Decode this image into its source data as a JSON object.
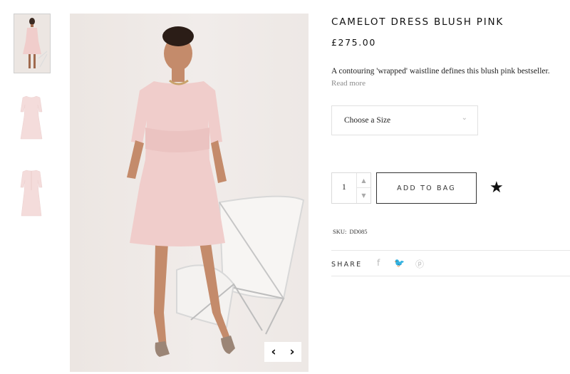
{
  "product": {
    "title": "CAMELOT DRESS BLUSH PINK",
    "price": "£275.00",
    "description": "A contouring 'wrapped' waistline defines this blush pink bestseller.",
    "read_more": "Read more",
    "sku_label": "SKU:",
    "sku_value": "DD085"
  },
  "gallery": {
    "thumbnails": [
      "model-front",
      "dress-front",
      "dress-back"
    ],
    "active_index": 0,
    "prev_icon": "‹",
    "next_icon": "›"
  },
  "size_select": {
    "placeholder": "Choose a Size",
    "chevron": "⌄"
  },
  "quantity": {
    "value": "1",
    "up_icon": "▲",
    "down_icon": "▼"
  },
  "cart": {
    "add_label": "ADD TO BAG",
    "wishlist_icon": "★"
  },
  "share": {
    "label": "SHARE",
    "facebook_icon": "f",
    "twitter_icon": "🐦",
    "pinterest_icon": "ⓟ"
  },
  "colors": {
    "dress": "#f0cdcb",
    "background": "#ece6e2",
    "accent": "#111111"
  }
}
